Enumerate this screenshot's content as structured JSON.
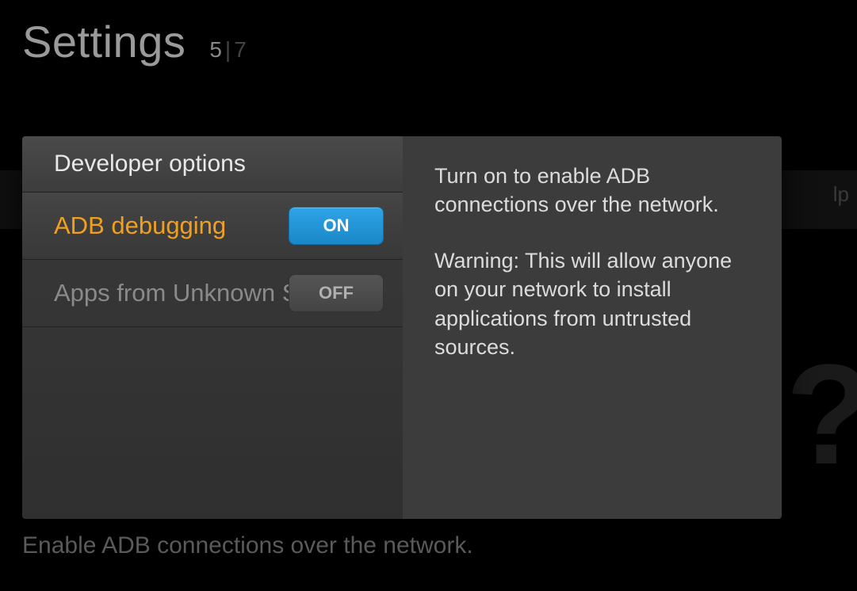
{
  "header": {
    "title": "Settings",
    "current": "5",
    "total": "7"
  },
  "panel": {
    "section_title": "Developer options",
    "items": [
      {
        "label": "ADB debugging",
        "state_label": "ON",
        "state": "on",
        "selected": true
      },
      {
        "label": "Apps from Unknown Sources",
        "state_label": "OFF",
        "state": "off",
        "selected": false
      }
    ]
  },
  "description": {
    "para1": "Turn on to enable ADB connections over the network.",
    "para2": "Warning: This will allow anyone on your network to install applications from untrusted sources."
  },
  "footer": "Enable ADB connections over the network.",
  "background": {
    "hint_right": "lp",
    "question": "?"
  }
}
